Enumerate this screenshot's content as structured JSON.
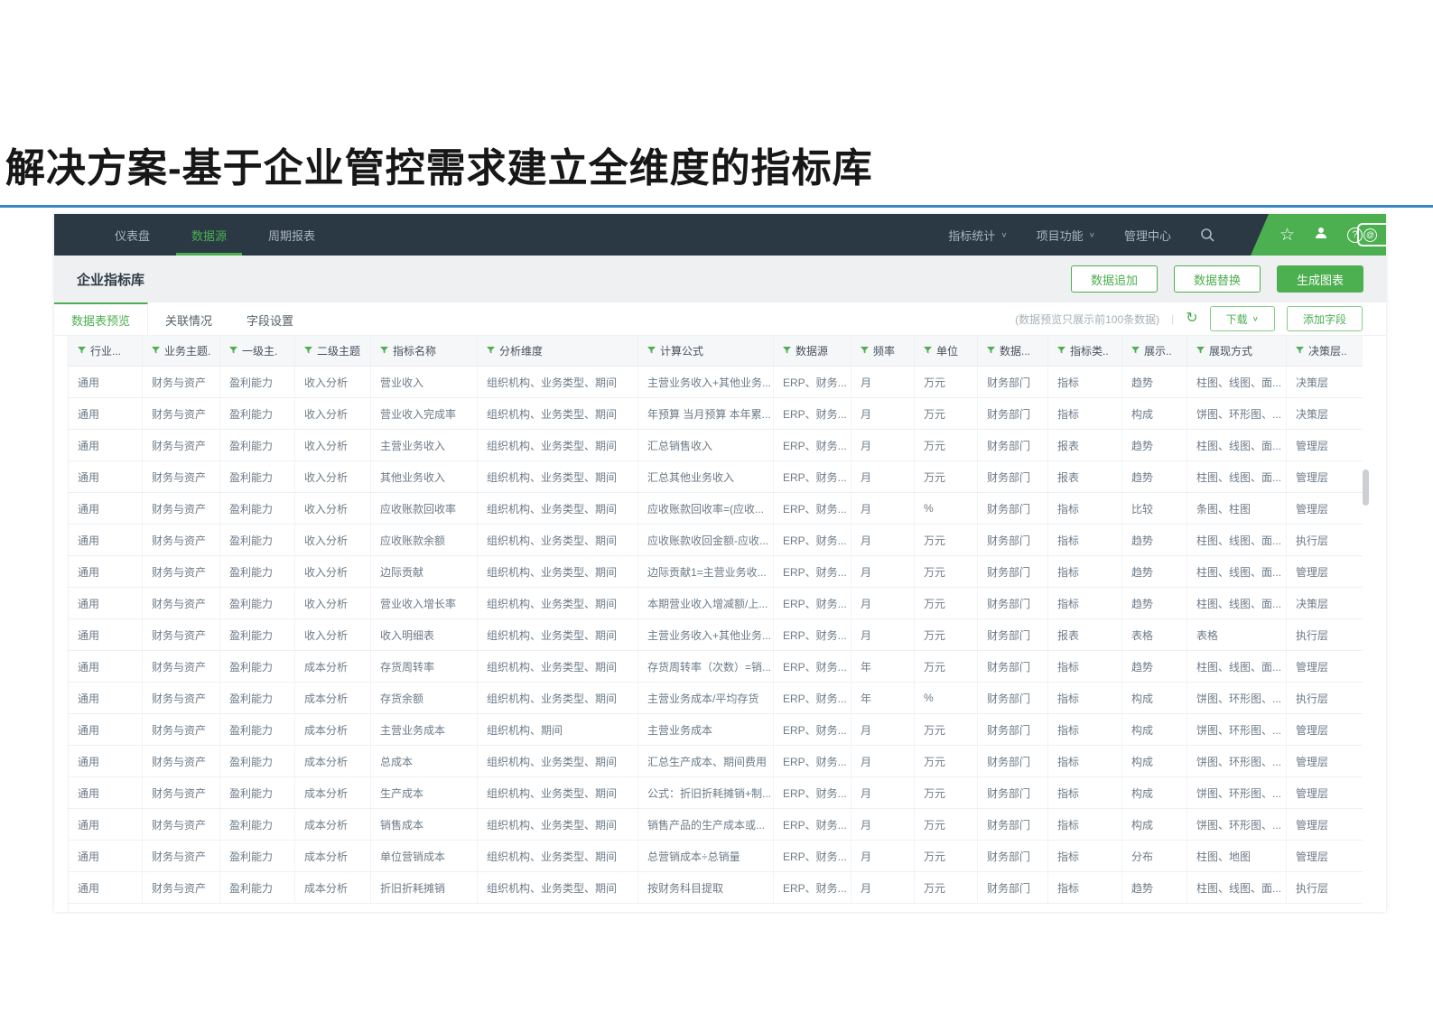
{
  "slide": {
    "title": "解决方案-基于企业管控需求建立全维度的指标库"
  },
  "navbar": {
    "tabs": [
      {
        "label": "仪表盘",
        "active": false
      },
      {
        "label": "数据源",
        "active": true
      },
      {
        "label": "周期报表",
        "active": false
      }
    ],
    "menus": [
      {
        "label": "指标统计",
        "caret": true
      },
      {
        "label": "项目功能",
        "caret": true
      },
      {
        "label": "管理中心",
        "caret": false
      }
    ],
    "icon_names": [
      "search-icon",
      "star-icon",
      "user-icon",
      "help-icon",
      "badge-icon"
    ]
  },
  "header": {
    "title": "企业指标库",
    "buttons": [
      {
        "label": "数据追加",
        "primary": false
      },
      {
        "label": "数据替换",
        "primary": false
      },
      {
        "label": "生成图表",
        "primary": true
      }
    ]
  },
  "subtabs": [
    {
      "label": "数据表预览",
      "active": true
    },
    {
      "label": "关联情况",
      "active": false
    },
    {
      "label": "字段设置",
      "active": false
    }
  ],
  "table_toolbar": {
    "note": "(数据预览只展示前100条数据)",
    "download_label": "下载",
    "add_field_label": "添加字段"
  },
  "table": {
    "columns": [
      "行业...",
      "业务主题.",
      "一级主.",
      "二级主题",
      "指标名称",
      "分析维度",
      "计算公式",
      "数据源",
      "频率",
      "单位",
      "数据...",
      "指标类..",
      "展示..",
      "展现方式",
      "决策层.."
    ],
    "rows": [
      [
        "通用",
        "财务与资产",
        "盈利能力",
        "收入分析",
        "营业收入",
        "组织机构、业务类型、期间",
        "主营业务收入+其他业务...",
        "ERP、财务...",
        "月",
        "万元",
        "财务部门",
        "指标",
        "趋势",
        "柱图、线图、面...",
        "决策层"
      ],
      [
        "通用",
        "财务与资产",
        "盈利能力",
        "收入分析",
        "营业收入完成率",
        "组织机构、业务类型、期间",
        "年预算 当月预算 本年累...",
        "ERP、财务...",
        "月",
        "万元",
        "财务部门",
        "指标",
        "构成",
        "饼图、环形图、...",
        "决策层"
      ],
      [
        "通用",
        "财务与资产",
        "盈利能力",
        "收入分析",
        "主营业务收入",
        "组织机构、业务类型、期间",
        "汇总销售收入",
        "ERP、财务...",
        "月",
        "万元",
        "财务部门",
        "报表",
        "趋势",
        "柱图、线图、面...",
        "管理层"
      ],
      [
        "通用",
        "财务与资产",
        "盈利能力",
        "收入分析",
        "其他业务收入",
        "组织机构、业务类型、期间",
        "汇总其他业务收入",
        "ERP、财务...",
        "月",
        "万元",
        "财务部门",
        "报表",
        "趋势",
        "柱图、线图、面...",
        "管理层"
      ],
      [
        "通用",
        "财务与资产",
        "盈利能力",
        "收入分析",
        "应收账款回收率",
        "组织机构、业务类型、期间",
        "应收账款回收率=(应收...",
        "ERP、财务...",
        "月",
        "%",
        "财务部门",
        "指标",
        "比较",
        "条图、柱图",
        "管理层"
      ],
      [
        "通用",
        "财务与资产",
        "盈利能力",
        "收入分析",
        "应收账款余额",
        "组织机构、业务类型、期间",
        "应收账款收回金额-应收...",
        "ERP、财务...",
        "月",
        "万元",
        "财务部门",
        "指标",
        "趋势",
        "柱图、线图、面...",
        "执行层"
      ],
      [
        "通用",
        "财务与资产",
        "盈利能力",
        "收入分析",
        "边际贡献",
        "组织机构、业务类型、期间",
        "边际贡献1=主营业务收...",
        "ERP、财务...",
        "月",
        "万元",
        "财务部门",
        "指标",
        "趋势",
        "柱图、线图、面...",
        "管理层"
      ],
      [
        "通用",
        "财务与资产",
        "盈利能力",
        "收入分析",
        "营业收入增长率",
        "组织机构、业务类型、期间",
        "本期营业收入增减额/上...",
        "ERP、财务...",
        "月",
        "万元",
        "财务部门",
        "指标",
        "趋势",
        "柱图、线图、面...",
        "决策层"
      ],
      [
        "通用",
        "财务与资产",
        "盈利能力",
        "收入分析",
        "收入明细表",
        "组织机构、业务类型、期间",
        "主营业务收入+其他业务...",
        "ERP、财务...",
        "月",
        "万元",
        "财务部门",
        "报表",
        "表格",
        "表格",
        "执行层"
      ],
      [
        "通用",
        "财务与资产",
        "盈利能力",
        "成本分析",
        "存货周转率",
        "组织机构、业务类型、期间",
        "存货周转率（次数）=销...",
        "ERP、财务...",
        "年",
        "万元",
        "财务部门",
        "指标",
        "趋势",
        "柱图、线图、面...",
        "管理层"
      ],
      [
        "通用",
        "财务与资产",
        "盈利能力",
        "成本分析",
        "存货余额",
        "组织机构、业务类型、期间",
        "主营业务成本/平均存货",
        "ERP、财务...",
        "年",
        "%",
        "财务部门",
        "指标",
        "构成",
        "饼图、环形图、...",
        "执行层"
      ],
      [
        "通用",
        "财务与资产",
        "盈利能力",
        "成本分析",
        "主营业务成本",
        "组织机构、期间",
        "主营业务成本",
        "ERP、财务...",
        "月",
        "万元",
        "财务部门",
        "指标",
        "构成",
        "饼图、环形图、...",
        "管理层"
      ],
      [
        "通用",
        "财务与资产",
        "盈利能力",
        "成本分析",
        "总成本",
        "组织机构、业务类型、期间",
        "汇总生产成本、期间费用",
        "ERP、财务...",
        "月",
        "万元",
        "财务部门",
        "指标",
        "构成",
        "饼图、环形图、...",
        "管理层"
      ],
      [
        "通用",
        "财务与资产",
        "盈利能力",
        "成本分析",
        "生产成本",
        "组织机构、业务类型、期间",
        "公式：折旧折耗摊销+制...",
        "ERP、财务...",
        "月",
        "万元",
        "财务部门",
        "指标",
        "构成",
        "饼图、环形图、...",
        "管理层"
      ],
      [
        "通用",
        "财务与资产",
        "盈利能力",
        "成本分析",
        "销售成本",
        "组织机构、业务类型、期间",
        "销售产品的生产成本或...",
        "ERP、财务...",
        "月",
        "万元",
        "财务部门",
        "指标",
        "构成",
        "饼图、环形图、...",
        "管理层"
      ],
      [
        "通用",
        "财务与资产",
        "盈利能力",
        "成本分析",
        "单位营销成本",
        "组织机构、业务类型、期间",
        "总营销成本÷总销量",
        "ERP、财务...",
        "月",
        "万元",
        "财务部门",
        "指标",
        "分布",
        "柱图、地图",
        "管理层"
      ],
      [
        "通用",
        "财务与资产",
        "盈利能力",
        "成本分析",
        "折旧折耗摊销",
        "组织机构、业务类型、期间",
        "按财务科目提取",
        "ERP、财务...",
        "月",
        "万元",
        "财务部门",
        "指标",
        "趋势",
        "柱图、线图、面...",
        "执行层"
      ]
    ]
  },
  "colors": {
    "accent": "#4caf50",
    "navbar_bg": "#2b3945",
    "title_rule": "#3488c8"
  }
}
